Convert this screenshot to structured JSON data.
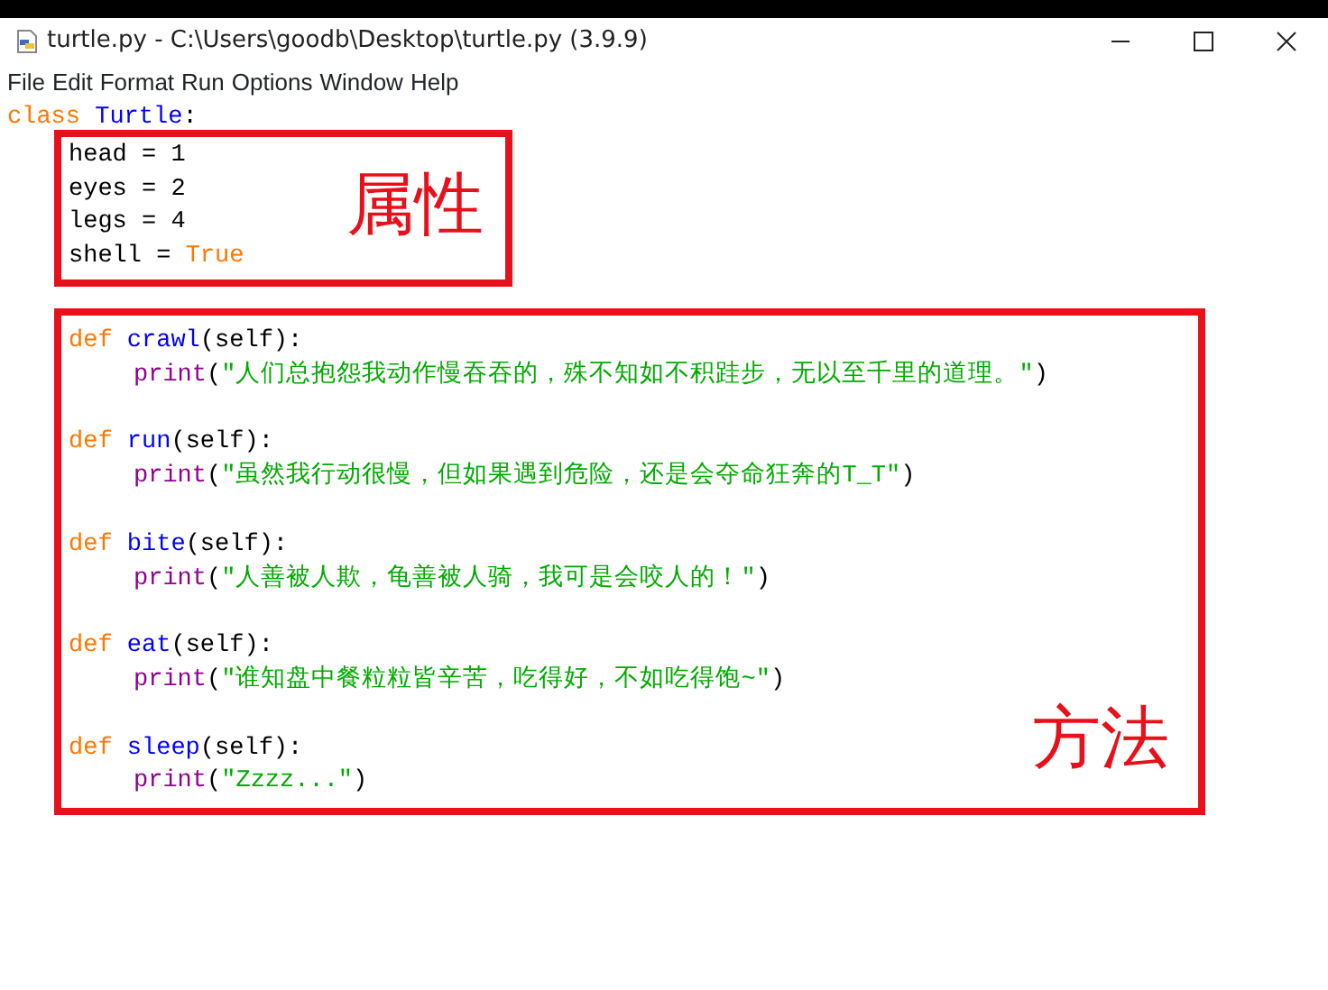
{
  "window": {
    "title": "turtle.py - C:\\Users\\goodb\\Desktop\\turtle.py (3.9.9)"
  },
  "menu": [
    "File",
    "Edit",
    "Format",
    "Run",
    "Options",
    "Window",
    "Help"
  ],
  "code": {
    "header": [
      {
        "text": "class",
        "kind": "keyword"
      },
      {
        "text": "Turtle",
        "kind": "definition"
      },
      {
        "text": ":",
        "kind": "plain"
      }
    ],
    "groups": [
      {
        "annotation": "属性",
        "lines": [
          {
            "tokens": [
              {
                "text": "head = 1",
                "kind": "plain"
              }
            ]
          },
          {
            "tokens": [
              {
                "text": "eyes = 2",
                "kind": "plain"
              }
            ]
          },
          {
            "tokens": [
              {
                "text": "legs = 4",
                "kind": "plain"
              }
            ]
          },
          {
            "tokens": [
              {
                "text": "shell = ",
                "kind": "plain"
              },
              {
                "text": "True",
                "kind": "keyword"
              }
            ]
          }
        ]
      },
      {
        "annotation": "方法",
        "lines": [
          {
            "tokens": [
              {
                "text": "def",
                "kind": "keyword"
              },
              {
                "text": "crawl",
                "kind": "definition"
              },
              {
                "text": "(self):",
                "kind": "plain"
              }
            ],
            "children": [
              {
                "tokens": [
                  {
                    "text": "print",
                    "kind": "builtin"
                  },
                  {
                    "text": "(",
                    "kind": "plain"
                  },
                  {
                    "text": "\"人们总抱怨我动作慢吞吞的，殊不知如不积跬步，无以至千里的道理。\"",
                    "kind": "string"
                  },
                  {
                    "text": ")",
                    "kind": "plain"
                  }
                ]
              }
            ]
          },
          {
            "tokens": [
              {
                "text": "def",
                "kind": "keyword"
              },
              {
                "text": "run",
                "kind": "definition"
              },
              {
                "text": "(self):",
                "kind": "plain"
              }
            ],
            "children": [
              {
                "tokens": [
                  {
                    "text": "print",
                    "kind": "builtin"
                  },
                  {
                    "text": "(",
                    "kind": "plain"
                  },
                  {
                    "text": "\"虽然我行动很慢，但如果遇到危险，还是会夺命狂奔的T_T\"",
                    "kind": "string"
                  },
                  {
                    "text": ")",
                    "kind": "plain"
                  }
                ]
              }
            ]
          },
          {
            "tokens": [
              {
                "text": "def",
                "kind": "keyword"
              },
              {
                "text": "bite",
                "kind": "definition"
              },
              {
                "text": "(self):",
                "kind": "plain"
              }
            ],
            "children": [
              {
                "tokens": [
                  {
                    "text": "print",
                    "kind": "builtin"
                  },
                  {
                    "text": "(",
                    "kind": "plain"
                  },
                  {
                    "text": "\"人善被人欺，龟善被人骑，我可是会咬人的！\"",
                    "kind": "string"
                  },
                  {
                    "text": ")",
                    "kind": "plain"
                  }
                ]
              }
            ]
          },
          {
            "tokens": [
              {
                "text": "def",
                "kind": "keyword"
              },
              {
                "text": "eat",
                "kind": "definition"
              },
              {
                "text": "(self):",
                "kind": "plain"
              }
            ],
            "children": [
              {
                "tokens": [
                  {
                    "text": "print",
                    "kind": "builtin"
                  },
                  {
                    "text": "(",
                    "kind": "plain"
                  },
                  {
                    "text": "\"谁知盘中餐粒粒皆辛苦，吃得好，不如吃得饱~\"",
                    "kind": "string"
                  },
                  {
                    "text": ")",
                    "kind": "plain"
                  }
                ]
              }
            ]
          },
          {
            "tokens": [
              {
                "text": "def",
                "kind": "keyword"
              },
              {
                "text": "sleep",
                "kind": "definition"
              },
              {
                "text": "(self):",
                "kind": "plain"
              }
            ],
            "children": [
              {
                "tokens": [
                  {
                    "text": "print",
                    "kind": "builtin"
                  },
                  {
                    "text": "(",
                    "kind": "plain"
                  },
                  {
                    "text": "\"Zzzz...\"",
                    "kind": "string"
                  },
                  {
                    "text": ")",
                    "kind": "plain"
                  }
                ]
              }
            ]
          }
        ]
      }
    ]
  }
}
